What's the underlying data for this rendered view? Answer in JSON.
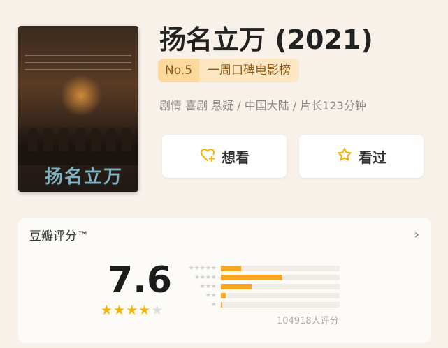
{
  "movie": {
    "title": "扬名立万 (2021)",
    "rank_num": "No.5",
    "rank_label": "一周口碑电影榜",
    "meta": "剧情 喜剧 悬疑 / 中国大陆 / 片长123分钟",
    "poster_title": "扬名立万"
  },
  "actions": {
    "want_label": "想看",
    "seen_label": "看过"
  },
  "rating": {
    "card_title": "豆瓣评分™",
    "score": "7.6",
    "stars_filled": 4,
    "stars_total": 5,
    "count_text": "104918人评分",
    "distribution": [
      {
        "stars": 5,
        "percent": 17
      },
      {
        "stars": 4,
        "percent": 52
      },
      {
        "stars": 3,
        "percent": 26
      },
      {
        "stars": 2,
        "percent": 4
      },
      {
        "stars": 1,
        "percent": 1
      }
    ]
  },
  "colors": {
    "accent": "#f5b300",
    "bar": "#f5a623",
    "rank_bg": "#fde7c3"
  }
}
